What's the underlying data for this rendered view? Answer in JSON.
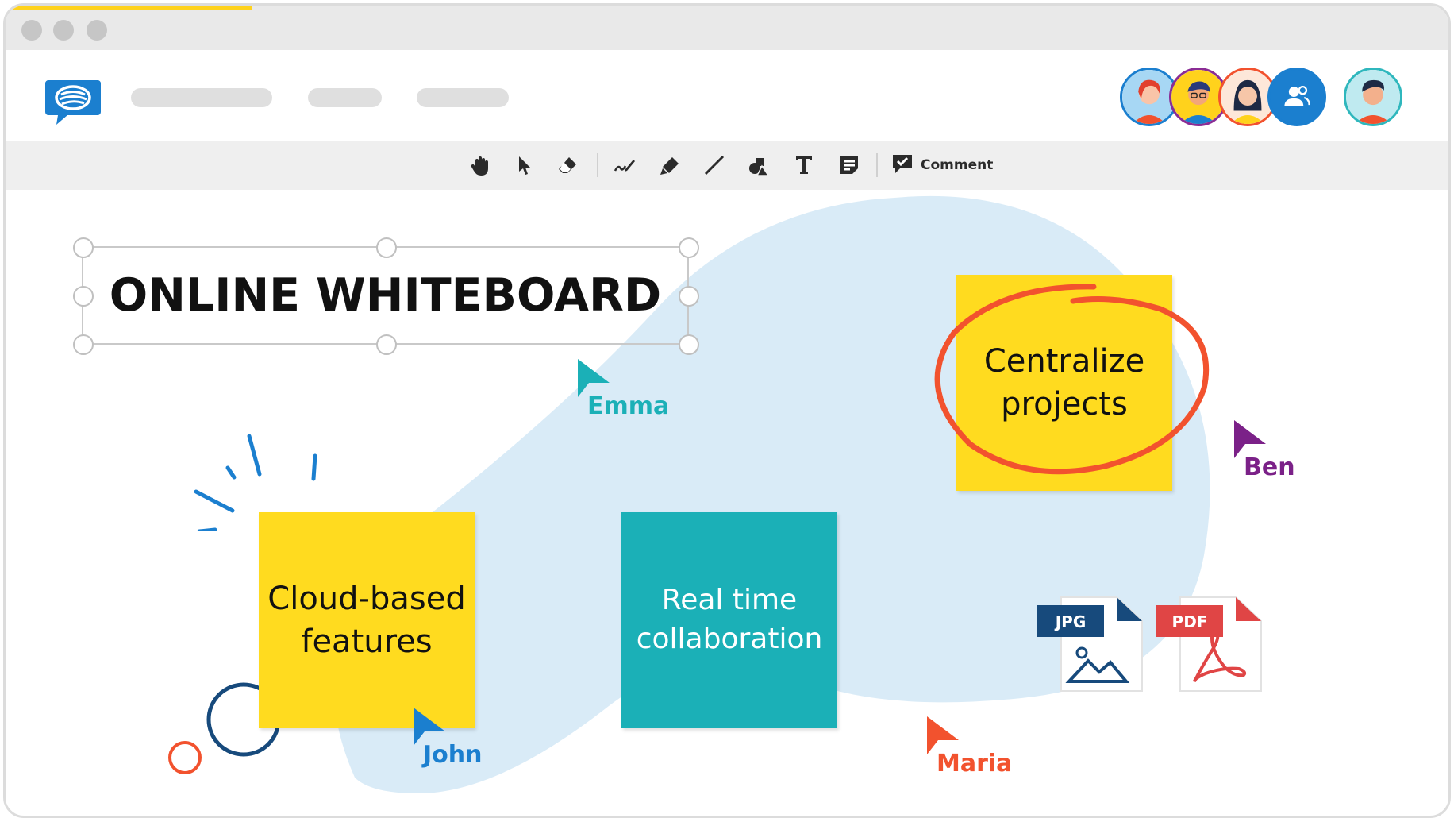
{
  "app": {
    "title": "Online Whiteboard",
    "colors": {
      "yellow": "#ffdb1f",
      "teal": "#1bb0b7",
      "blob": "#d9ebf7",
      "red_circle": "#f2522e",
      "blue": "#1b7fcf"
    }
  },
  "window": {
    "controls": [
      "close-dot",
      "minimize-dot",
      "maximize-dot"
    ]
  },
  "header": {
    "logo_icon": "chat-bubble-logo",
    "nav_placeholders": [
      "nav-1",
      "nav-2",
      "nav-3"
    ],
    "collaborators": [
      {
        "name": "avatar-woman-red-hair",
        "ring": "#1b7fcf",
        "bg": "#a7d7f4"
      },
      {
        "name": "avatar-man-glasses",
        "ring": "#8a2c95",
        "bg": "#ffd21c"
      },
      {
        "name": "avatar-woman-dark-hair",
        "ring": "#f2522e",
        "bg": "#f6b4a5"
      },
      {
        "name": "users-icon",
        "ring": "#1b7fcf",
        "bg": "#1b7fcf"
      }
    ],
    "current_user": {
      "name": "avatar-current-user",
      "ring": "#2fb7bd",
      "bg": "#bfeaf0"
    }
  },
  "toolbar": {
    "tools": [
      {
        "icon": "hand-icon",
        "label": "Pan"
      },
      {
        "icon": "pointer-icon",
        "label": "Select"
      },
      {
        "icon": "eraser-icon",
        "label": "Eraser"
      },
      {
        "icon": "pen-icon",
        "label": "Pen"
      },
      {
        "icon": "highlighter-icon",
        "label": "Highlighter"
      },
      {
        "icon": "line-icon",
        "label": "Line"
      },
      {
        "icon": "shapes-icon",
        "label": "Shapes"
      },
      {
        "icon": "text-icon",
        "label": "Text"
      },
      {
        "icon": "sticky-note-icon",
        "label": "Sticky note"
      }
    ],
    "comment_label": "Comment"
  },
  "board": {
    "title": "ONLINE WHITEBOARD",
    "notes": [
      {
        "id": "cloud",
        "text": "Cloud-based\nfeatures",
        "color": "yellow"
      },
      {
        "id": "realtime",
        "text": "Real time\ncollaboration",
        "color": "teal"
      },
      {
        "id": "centralize",
        "text": "Centralize\nprojects",
        "color": "yellow"
      }
    ],
    "cursors": [
      {
        "name": "Emma",
        "color": "#1bb0b7"
      },
      {
        "name": "Ben",
        "color": "#7b2188"
      },
      {
        "name": "John",
        "color": "#1b7fcf"
      },
      {
        "name": "Maria",
        "color": "#f2522e"
      }
    ],
    "files": [
      {
        "type": "JPG",
        "label_color": "#174a7c"
      },
      {
        "type": "PDF",
        "label_color": "#e04545"
      }
    ]
  }
}
